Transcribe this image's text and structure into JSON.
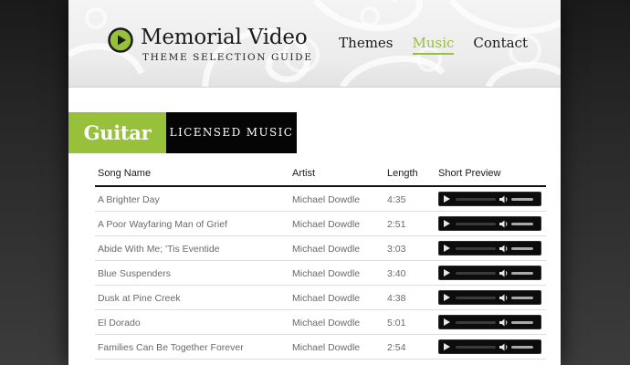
{
  "brand": {
    "title": "Memorial Video",
    "subtitle": "THEME SELECTION GUIDE",
    "logo_icon": "play-icon"
  },
  "nav": {
    "items": [
      {
        "label": "Themes",
        "active": false
      },
      {
        "label": "Music",
        "active": true
      },
      {
        "label": "Contact",
        "active": false
      }
    ]
  },
  "section": {
    "category": "Guitar",
    "tag": "LICENSED MUSIC"
  },
  "table": {
    "headers": {
      "song": "Song Name",
      "artist": "Artist",
      "length": "Length",
      "preview": "Short Preview"
    },
    "rows": [
      {
        "song": "A Brighter Day",
        "artist": "Michael Dowdle",
        "length": "4:35"
      },
      {
        "song": "A Poor Wayfaring Man of Grief",
        "artist": "Michael Dowdle",
        "length": "2:51"
      },
      {
        "song": "Abide With Me; 'Tis Eventide",
        "artist": "Michael Dowdle",
        "length": "3:03"
      },
      {
        "song": "Blue Suspenders",
        "artist": "Michael Dowdle",
        "length": "3:40"
      },
      {
        "song": "Dusk at Pine Creek",
        "artist": "Michael Dowdle",
        "length": "4:38"
      },
      {
        "song": "El Dorado",
        "artist": "Michael Dowdle",
        "length": "5:01"
      },
      {
        "song": "Families Can Be Together Forever",
        "artist": "Michael Dowdle",
        "length": "2:54"
      }
    ]
  },
  "player": {
    "icons": [
      "play-icon",
      "speaker-icon"
    ]
  },
  "colors": {
    "accent": "#97c13a",
    "dark": "#050505",
    "background": "#2a2a2a"
  }
}
